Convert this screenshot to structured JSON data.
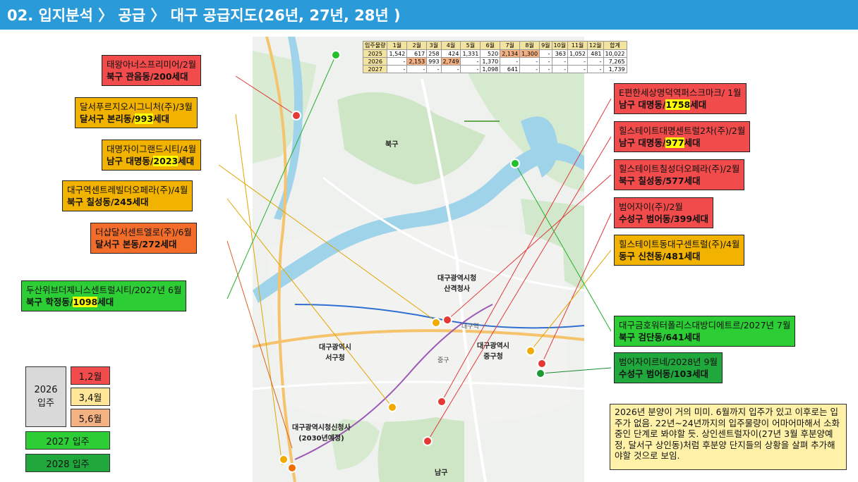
{
  "header": {
    "title": "02. 입지분석 〉 공급 〉 대구 공급지도(26년, 27년, 28년 )"
  },
  "supply_table": {
    "columns": [
      "입주물량",
      "1월",
      "2월",
      "3월",
      "4월",
      "5월",
      "6월",
      "7월",
      "8월",
      "9월",
      "10월",
      "11월",
      "12월",
      "합계"
    ],
    "rows": [
      [
        "2025",
        "1,542",
        "617",
        "258",
        "424",
        "1,331",
        "520",
        "2,134",
        "1,300",
        "-",
        "363",
        "1,052",
        "481",
        "10,022"
      ],
      [
        "2026",
        "-",
        "2,153",
        "993",
        "2,749",
        "-",
        "1,370",
        "-",
        "-",
        "-",
        "-",
        "-",
        "-",
        "7,265"
      ],
      [
        "2027",
        "-",
        "-",
        "-",
        "-",
        "-",
        "1,098",
        "641",
        "-",
        "-",
        "-",
        "-",
        "-",
        "1,739"
      ]
    ]
  },
  "callouts": [
    {
      "line1": "태왕아너스프리미어/2월",
      "line2a": "북구 관음동/",
      "hl": "",
      "line2b": "200세대"
    },
    {
      "line1": "달서푸르지오시그니처(주)/3월",
      "line2a": "달서구 본리동/",
      "hl": "993",
      "line2b": "세대"
    },
    {
      "line1": "대명자이그랜드시티/4월",
      "line2a": "남구 대명동/",
      "hl": "2023",
      "line2b": "세대"
    },
    {
      "line1": "대구역센트레빌더오페라(주)/4월",
      "line2a": "북구 칠성동/",
      "hl": "",
      "line2b": "245세대"
    },
    {
      "line1": "더샵달서센트엘로(주)/6월",
      "line2a": "달서구 본동/",
      "hl": "",
      "line2b": "272세대"
    },
    {
      "line1": "두산위브더제니스센트럴시티/2027년 6월",
      "line2a": "북구 학정동/",
      "hl": "1098",
      "line2b": "세대"
    },
    {
      "line1": "E편한세상명덕역퍼스크마크/ 1월",
      "line2a": "남구 대명동/",
      "hl": "1758",
      "line2b": "세대"
    },
    {
      "line1": "힐스테이트대명센트럴2차(주)/2월",
      "line2a": "남구 대명동/",
      "hl": "977",
      "line2b": "세대"
    },
    {
      "line1": "힐스테이트칠성더오페라(주)/2월",
      "line2a": "북구 칠성동/",
      "hl": "",
      "line2b": "577세대"
    },
    {
      "line1": "범어자이(주)/2월",
      "line2a": "수성구 범어동/",
      "hl": "",
      "line2b": "399세대"
    },
    {
      "line1": "힐스테이트동대구센트럴(주)/4월",
      "line2a": "동구 신천동/",
      "hl": "",
      "line2b": "481세대"
    },
    {
      "line1": "대구금호워터폴리스대방디에트르/2027년 7월",
      "line2a": "북구 검단동/",
      "hl": "",
      "line2b": "641세대"
    },
    {
      "line1": "범어자이르네/2028년 9월",
      "line2a": "수성구 범어동/",
      "hl": "",
      "line2b": "103세대"
    }
  ],
  "legend": {
    "group_2026": "2026\n입주",
    "m12": "1,2월",
    "m34": "3,4월",
    "m56": "5,6월",
    "y2027": "2027 입주",
    "y2028": "2028 입주"
  },
  "note": "2026년 분양이 거의 미미. 6월까지 입주가 있고 이후로는 입주가 없음. 22년~24년까지의 입주물량이 어마어마해서 소화중인 단계로 봐야할 듯. 상인센트럴자이(27년 3월 후분양예정, 달서구 상인동)처럼 후분양 단지들의 상황을 살펴 추가해야할 것으로 보임.",
  "map_labels": {
    "bukgu": "북구",
    "seogu": "대구광역시\n서구청",
    "city_hall": "대구광역시청\n산격청사",
    "junggu": "대구광역시\n중구청",
    "new_hall": "대구광역시청신청사\n(2030년예정)",
    "namgu": "남구",
    "jung": "중구",
    "station": "대구역"
  },
  "colors": {
    "header": "#2a9bd8",
    "red": "#f24b4b",
    "gold": "#f2b200",
    "orange": "#f36d2a",
    "green": "#2ccd35",
    "dark_green": "#21a83d",
    "table_header": "#f3e3a0",
    "table_highlight": "#f4b183",
    "legend_2026": "#d9d9d9",
    "legend_12": "#f24b4b",
    "legend_34": "#ffe699",
    "legend_56": "#f4b183",
    "note_bg": "#fff2a8",
    "highlight": "#ffff00"
  }
}
